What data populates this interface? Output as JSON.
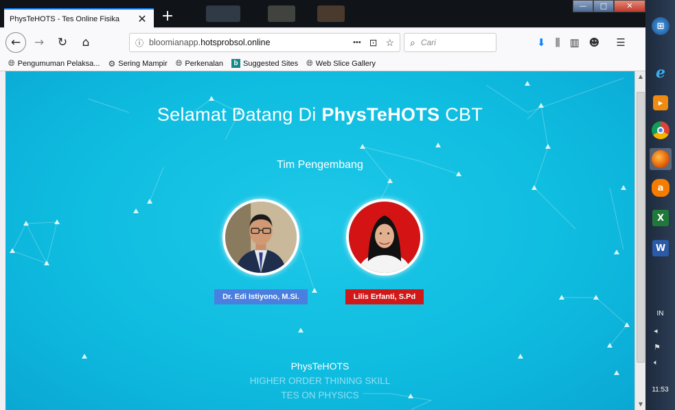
{
  "browser": {
    "tab": {
      "title": "PhysTeHOTS - Tes Online Fisika",
      "close_glyph": "✕"
    },
    "new_tab_glyph": "+",
    "window_controls": {
      "minimize": "—",
      "maximize": "□",
      "close": "✕"
    },
    "nav": {
      "back": "←",
      "forward": "→",
      "reload": "↻",
      "home": "⌂",
      "url_prefix": "bloomianapp.",
      "url_domain": "hotsprobsol.online",
      "url_more": "•••",
      "pocket": "⊡",
      "bookmark_star": "☆",
      "search_placeholder": "Cari",
      "search_glyph": "⌕",
      "download": "⬇",
      "library": "⫼",
      "sidebar": "▥",
      "account": "☻",
      "menu": "☰"
    },
    "bookmarks": [
      {
        "label": "Pengumuman Pelaksa...",
        "icon": "globe-icon"
      },
      {
        "label": "Sering Mampir",
        "icon": "gear-icon"
      },
      {
        "label": "Perkenalan",
        "icon": "globe-icon"
      },
      {
        "label": "Suggested Sites",
        "icon": "bing-icon"
      },
      {
        "label": "Web Slice Gallery",
        "icon": "globe-icon"
      }
    ]
  },
  "page": {
    "welcome_prefix": "Selamat Datang Di ",
    "welcome_brand": "PhysTeHOTS",
    "welcome_suffix": " CBT",
    "team_heading": "Tim Pengembang",
    "members": [
      {
        "name": "Dr. Edi Istiyono, M.Si.",
        "badge_color": "#4a7fe0"
      },
      {
        "name": "Lilis Erfanti, S.Pd",
        "badge_color": "#d01818"
      }
    ],
    "footer": {
      "title": "PhysTeHOTS",
      "line1": "HIGHER ORDER THINING SKILL",
      "line2": "TES ON PHYSICS"
    },
    "background_color": "#10bfe2"
  },
  "taskbar": {
    "items": [
      "windows-start-icon",
      "ie-icon",
      "blank-app-icon",
      "chrome-icon",
      "firefox-icon",
      "avast-icon",
      "excel-icon",
      "word-icon"
    ],
    "language": "IN",
    "clock": "11:53"
  }
}
